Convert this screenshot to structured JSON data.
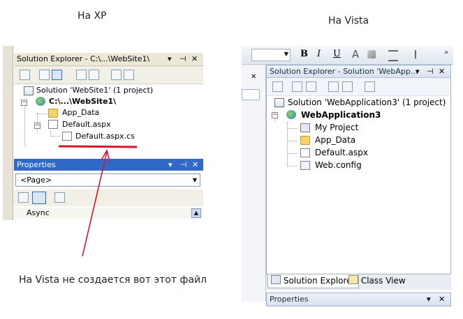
{
  "captions": {
    "xp": "На XP",
    "vista": "На Vista",
    "annotation": "На Vista не создается вот этот файл"
  },
  "xp": {
    "solution_explorer": {
      "title": "Solution Explorer - C:\\...\\WebSite1\\",
      "controls": [
        "▾",
        "⊣",
        "✕"
      ],
      "tree": [
        {
          "label": "Solution 'WebSite1' (1 project)"
        },
        {
          "label": "C:\\...\\WebSite1\\"
        },
        {
          "label": "App_Data"
        },
        {
          "label": "Default.aspx"
        },
        {
          "label": "Default.aspx.cs"
        }
      ]
    },
    "properties": {
      "title": "Properties",
      "controls": [
        "▾",
        "⊣",
        "✕"
      ],
      "combo_value": "<Page>",
      "row_label": "Async"
    }
  },
  "vista": {
    "solution_explorer": {
      "title": "Solution Explorer - Solution 'WebApp...",
      "controls": [
        "▾",
        "⊣",
        "✕"
      ],
      "tree": [
        {
          "label": "Solution 'WebApplication3' (1 project)"
        },
        {
          "label": "WebApplication3"
        },
        {
          "label": "My Project"
        },
        {
          "label": "App_Data"
        },
        {
          "label": "Default.aspx"
        },
        {
          "label": "Web.config"
        }
      ]
    },
    "tabs": [
      "Solution Explorer",
      "Class View"
    ],
    "properties_title": "Properties",
    "properties_controls": [
      "▾",
      "✕"
    ],
    "toolbar_labels": {
      "bold": "B",
      "italic": "I",
      "underline": "U",
      "font_color": "A"
    }
  },
  "colors": {
    "annotation_red": "#d6142c",
    "xp_props_bar": "#3169c6",
    "vista_frame": "#9fb1c6"
  }
}
